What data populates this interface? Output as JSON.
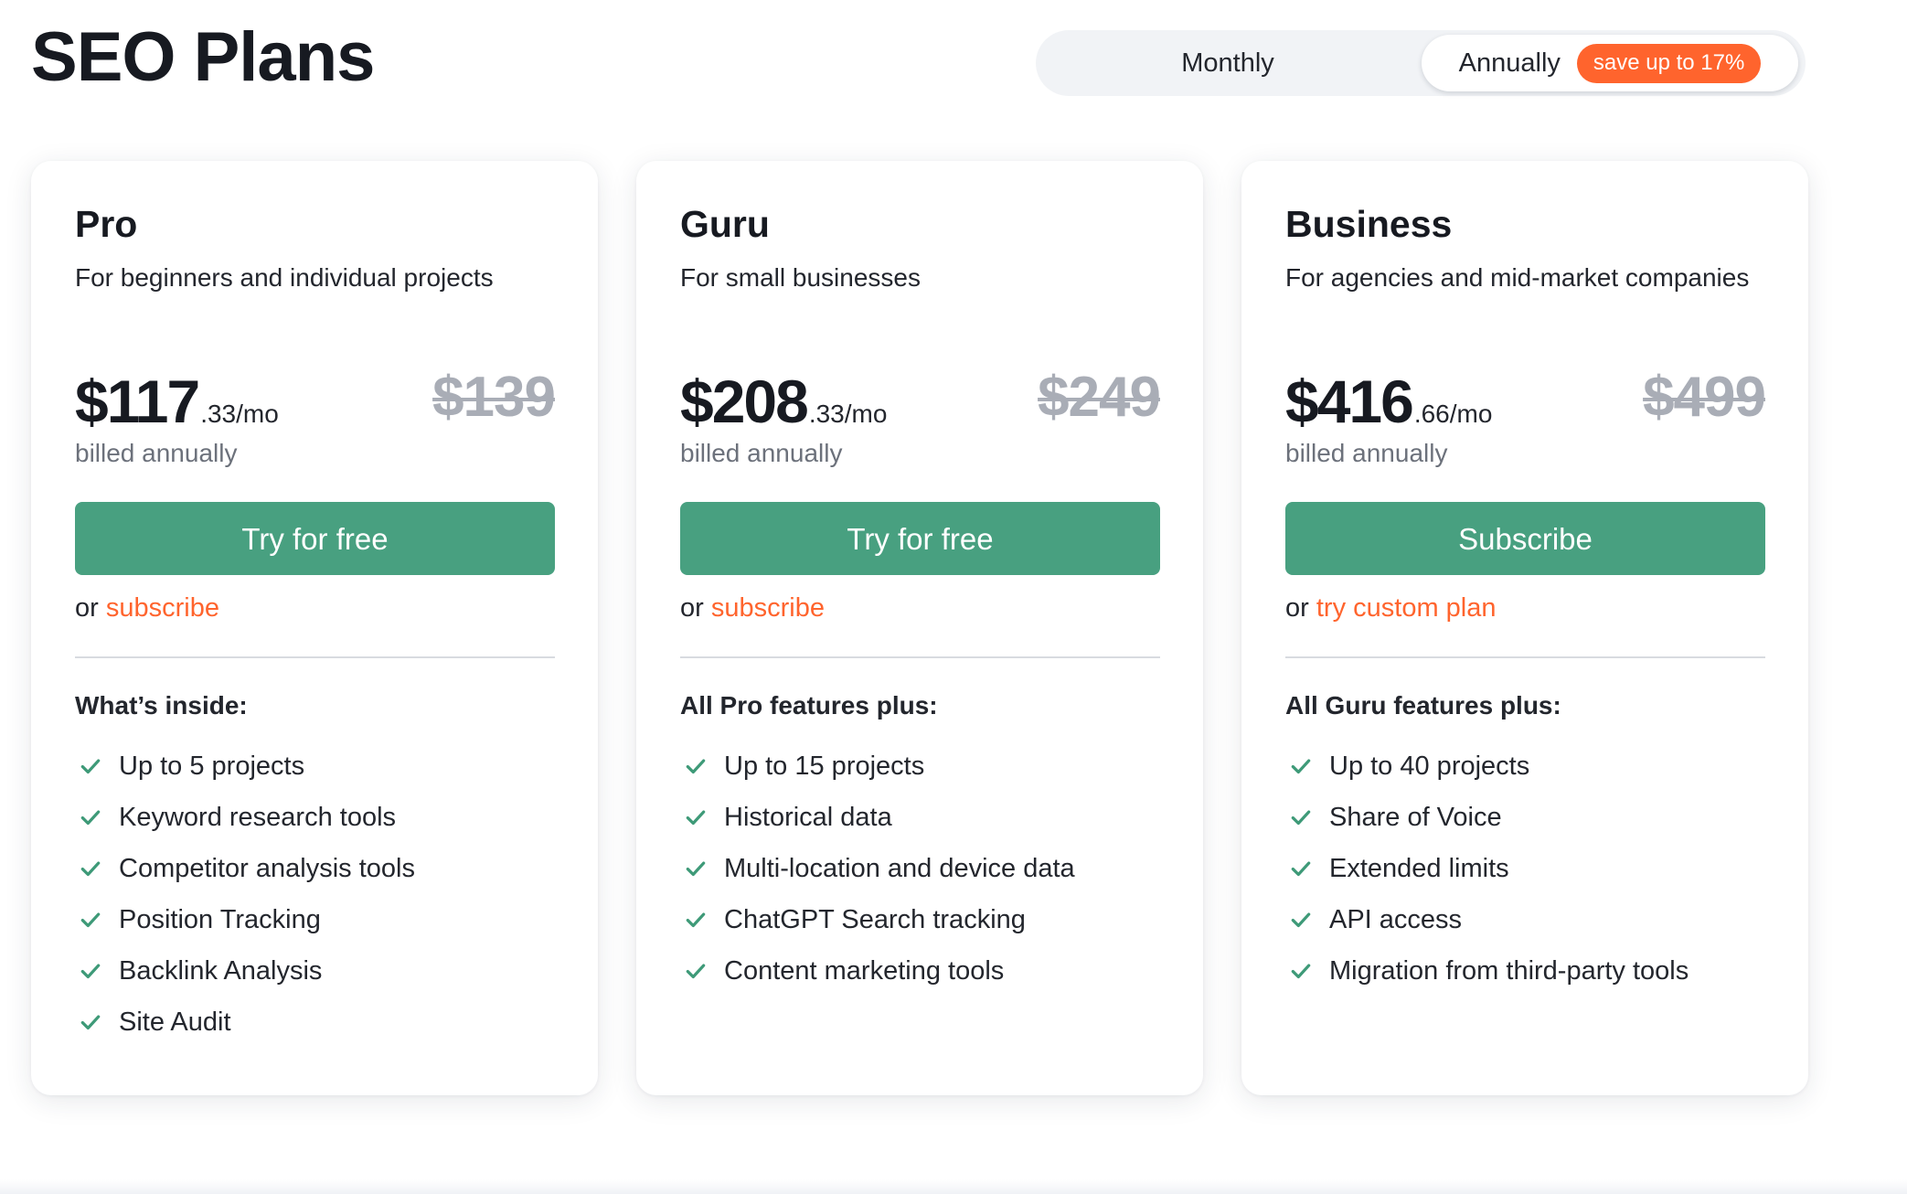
{
  "page": {
    "title": "SEO Plans"
  },
  "billing_toggle": {
    "options": [
      "Monthly",
      "Annually"
    ],
    "selected": "Annually",
    "monthly_label": "Monthly",
    "annually_label": "Annually",
    "save_badge": "save up to 17%"
  },
  "colors": {
    "accent_green": "#48a080",
    "accent_orange": "#ff642d",
    "check_green": "#3e9a78"
  },
  "plans": [
    {
      "name": "Pro",
      "description": "For beginners and individual projects",
      "price_whole": "$117",
      "price_cents": ".33/mo",
      "old_price": "$139",
      "billed_note": "billed annually",
      "cta_label": "Try for free",
      "alt_prefix": "or",
      "alt_link": "subscribe",
      "features_heading": "What’s inside:",
      "features": [
        "Up to 5 projects",
        "Keyword research tools",
        "Competitor analysis tools",
        "Position Tracking",
        "Backlink Analysis",
        "Site Audit"
      ]
    },
    {
      "name": "Guru",
      "description": "For small businesses",
      "price_whole": "$208",
      "price_cents": ".33/mo",
      "old_price": "$249",
      "billed_note": "billed annually",
      "cta_label": "Try for free",
      "alt_prefix": "or",
      "alt_link": "subscribe",
      "features_heading": "All Pro features plus:",
      "features": [
        "Up to 15 projects",
        "Historical data",
        "Multi-location and device data",
        "ChatGPT Search tracking",
        "Content marketing tools"
      ]
    },
    {
      "name": "Business",
      "description": "For agencies and mid-market companies",
      "price_whole": "$416",
      "price_cents": ".66/mo",
      "old_price": "$499",
      "billed_note": "billed annually",
      "cta_label": "Subscribe",
      "alt_prefix": "or",
      "alt_link": "try custom plan",
      "features_heading": "All Guru features plus:",
      "features": [
        "Up to 40 projects",
        "Share of Voice",
        "Extended limits",
        "API access",
        "Migration from third-party tools"
      ]
    }
  ]
}
